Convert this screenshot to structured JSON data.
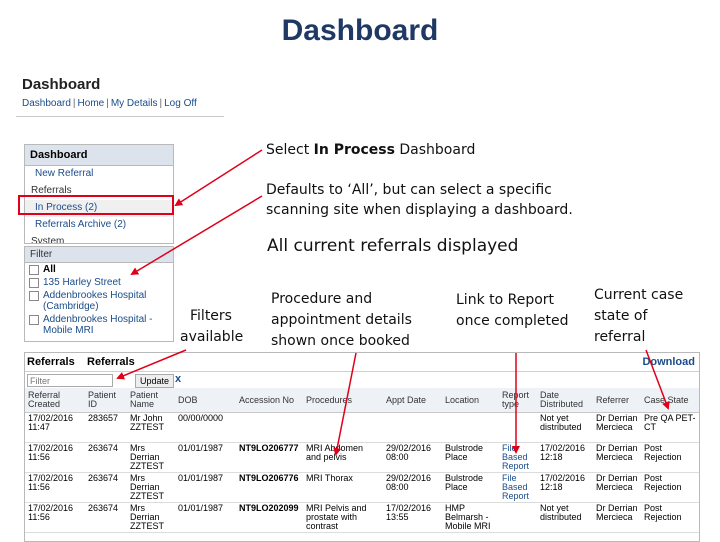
{
  "slide_title": "Dashboard",
  "top_panel": {
    "title": "Dashboard",
    "links": [
      "Dashboard",
      "Home",
      "My Details",
      "Log Off"
    ]
  },
  "nav": {
    "header": "Dashboard",
    "items": [
      {
        "label": "New Referral",
        "type": "link"
      },
      {
        "label": "Referrals",
        "type": "section"
      },
      {
        "label": "In Process (2)",
        "type": "link"
      },
      {
        "label": "Referrals Archive (2)",
        "type": "link"
      },
      {
        "label": "System",
        "type": "section"
      }
    ]
  },
  "filter": {
    "header": "Filter",
    "options": [
      "All",
      "135 Harley Street",
      "Addenbrookes Hospital (Cambridge)",
      "Addenbrookes Hospital - Mobile MRI"
    ]
  },
  "annotations": {
    "select_prefix": "Select ",
    "select_bold": "In Process",
    "select_suffix": " Dashboard",
    "defaults_line1": "Defaults to ‘All’, but can select  a specific",
    "defaults_line2": "scanning site when displaying a dashboard.",
    "all_current": "All current referrals displayed",
    "filters_line1": "Filters",
    "filters_line2": "available",
    "procedure_line1": "Procedure and",
    "procedure_line2": "appointment details",
    "procedure_line3": "shown once booked",
    "link_line1": "Link to Report",
    "link_line2": "once completed",
    "case_line1": "Current case",
    "case_line2": "state of",
    "case_line3": "referral"
  },
  "referrals": {
    "title1": "Referrals",
    "title2": "Referrals",
    "download": "Download",
    "search_placeholder": "Filter",
    "update_label": "Update",
    "clear_label": "x",
    "columns": [
      "Referral Created",
      "Patient ID",
      "Patient Name",
      "DOB",
      "Accession No",
      "Procedures",
      "Appt Date",
      "Location",
      "Report type",
      "Date Distributed",
      "Referrer",
      "Case State"
    ],
    "rows": [
      [
        "17/02/2016 11:47",
        "283657",
        "Mr John ZZTEST",
        "00/00/0000",
        "",
        "",
        "",
        "",
        "",
        "Not yet distributed",
        "Dr Derrian Mercieca",
        "Pre QA PET-CT"
      ],
      [
        "17/02/2016 11:56",
        "263674",
        "Mrs Derrian ZZTEST",
        "01/01/1987",
        "NT9LO206777",
        "MRI Abdomen and pelvis",
        "29/02/2016 08:00",
        "Bulstrode Place",
        "File Based Report",
        "17/02/2016 12:18",
        "Dr Derrian Mercieca",
        "Post Rejection"
      ],
      [
        "17/02/2016 11:56",
        "263674",
        "Mrs Derrian ZZTEST",
        "01/01/1987",
        "NT9LO206776",
        "MRI Thorax",
        "29/02/2016 08:00",
        "Bulstrode Place",
        "File Based Report",
        "17/02/2016 12:18",
        "Dr Derrian Mercieca",
        "Post Rejection"
      ],
      [
        "17/02/2016 11:56",
        "263674",
        "Mrs Derrian ZZTEST",
        "01/01/1987",
        "NT9LO202099",
        "MRI Pelvis and prostate with contrast",
        "17/02/2016 13:55",
        "HMP Belmarsh - Mobile MRI",
        "",
        "Not yet distributed",
        "Dr Derrian Mercieca",
        "Post Rejection"
      ]
    ]
  },
  "colors": {
    "title": "#1f3864",
    "link": "#1a4c8b",
    "highlight": "#e0001a"
  }
}
